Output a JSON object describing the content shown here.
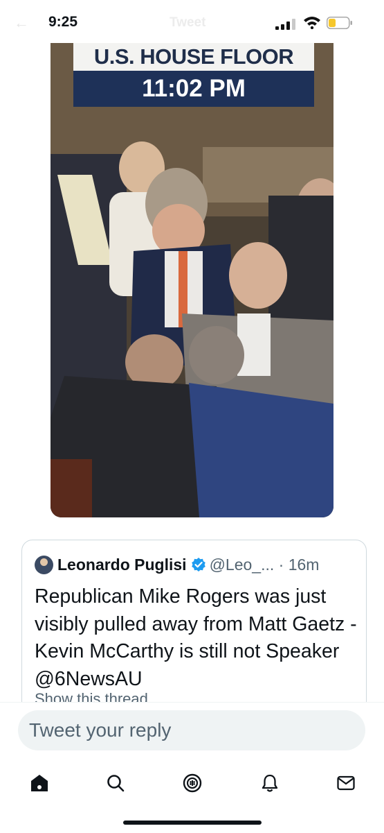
{
  "status_bar": {
    "time": "9:25",
    "ghost_title": "Tweet",
    "battery_color": "#f6c72b"
  },
  "media": {
    "chyron_line1": "U.S. HOUSE FLOOR",
    "chyron_line2": "11:02 PM"
  },
  "quote": {
    "author_name": "Leonardo Puglisi",
    "handle_time": "@Leo_... · 16m",
    "text": "Republican Mike Rogers was just visibly pulled away from Matt Gaetz - Kevin McCarthy is still not Speaker @6NewsAU",
    "cut_line": "Show this thread"
  },
  "reply": {
    "placeholder": "Tweet your reply"
  },
  "nav": {
    "items": [
      "home-icon",
      "search-icon",
      "spaces-icon",
      "notifications-icon",
      "messages-icon"
    ],
    "active": "home-icon"
  },
  "colors": {
    "verified": "#1d9bf0",
    "secondary_text": "#536471",
    "chyron_navy": "#1e3158"
  }
}
